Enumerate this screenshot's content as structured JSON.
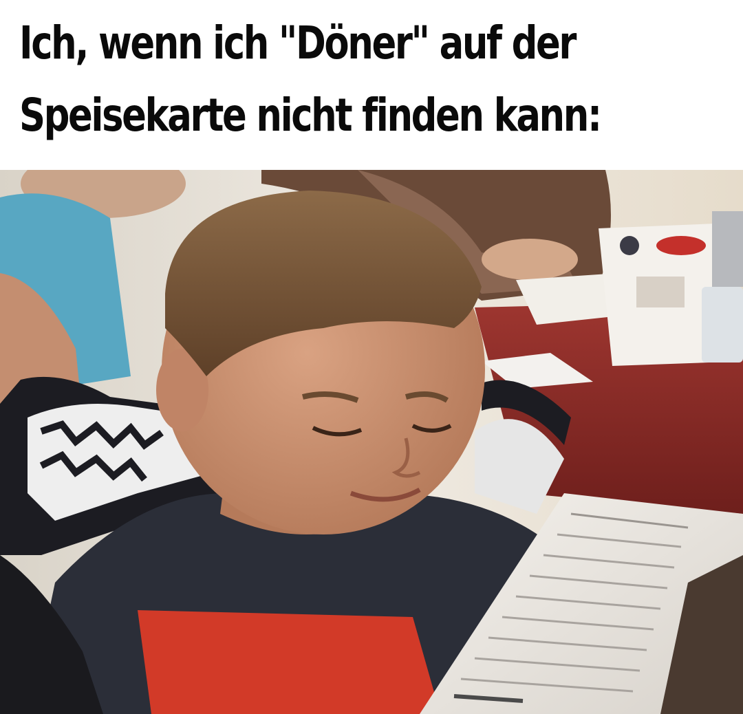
{
  "caption": {
    "line1": "Ich, wenn ich \"Döner\" auf der",
    "line2": "Speisekarte nicht finden kann:"
  },
  "photo": {
    "subject": "boy-reading-menu",
    "colors": {
      "background_wall": "#e8e2d8",
      "table": "#8a2b27",
      "shirt": "#2b2e38",
      "shirt_print": "#d23a28",
      "skin": "#c58e6e",
      "hair": "#7a5a3c",
      "menu_paper": "#ece8e2"
    }
  }
}
